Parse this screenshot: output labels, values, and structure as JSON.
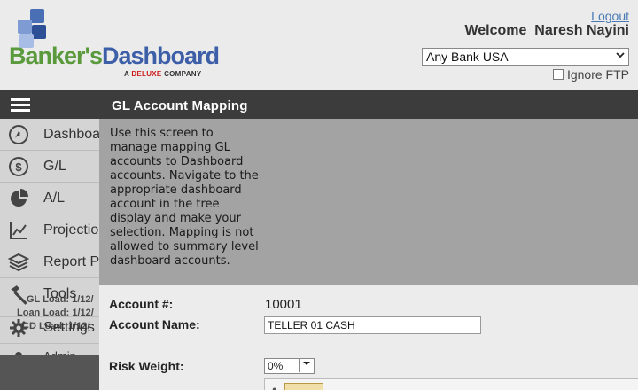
{
  "brand": {
    "name_part1": "Banker's",
    "name_part2": "Dashboard",
    "tagline_prefix": "A ",
    "tagline_brand": "DELUXE",
    "tagline_suffix": " COMPANY"
  },
  "header": {
    "logout_label": "Logout",
    "welcome_text": "Welcome  Naresh Nayini",
    "bank_select_value": "Any Bank USA",
    "ignore_ftp_label": "Ignore FTP"
  },
  "sidebar": {
    "items": [
      {
        "label": "Dashboard",
        "icon": "dashboard-gauge-icon"
      },
      {
        "label": "G/L",
        "icon": "dollar-icon"
      },
      {
        "label": "A/L",
        "icon": "pie-chart-icon"
      },
      {
        "label": "Projections",
        "icon": "line-chart-icon"
      },
      {
        "label": "Report Pack",
        "icon": "layers-icon"
      },
      {
        "label": "Tools",
        "icon": "hammer-icon"
      },
      {
        "label": "Settings",
        "icon": "gear-icon"
      },
      {
        "label": "Admin",
        "icon": "user-icon"
      }
    ],
    "load_lines": [
      "GL Load: 1/12/",
      "Loan Load: 1/12/",
      "CD Load: 1/12/"
    ]
  },
  "panel": {
    "title": "GL Account Mapping",
    "description": "Use this screen to manage mapping GL accounts to Dashboard accounts. Navigate to the appropriate dashboard account in the tree display and make your selection. Mapping is not allowed to summary level dashboard accounts."
  },
  "form": {
    "account_number_label": "Account #:",
    "account_number_value": "10001",
    "account_name_label": "Account Name:",
    "account_name_value": "TELLER 01 CASH",
    "risk_weight_label": "Risk Weight:",
    "risk_weight_value": "0%"
  },
  "colors": {
    "panel_header": "#3c3c3c",
    "description_bg": "#a3a3a3",
    "logo_green": "#5a9a3c",
    "logo_blue": "#3d5fa8",
    "link_blue": "#4a7ab5"
  }
}
